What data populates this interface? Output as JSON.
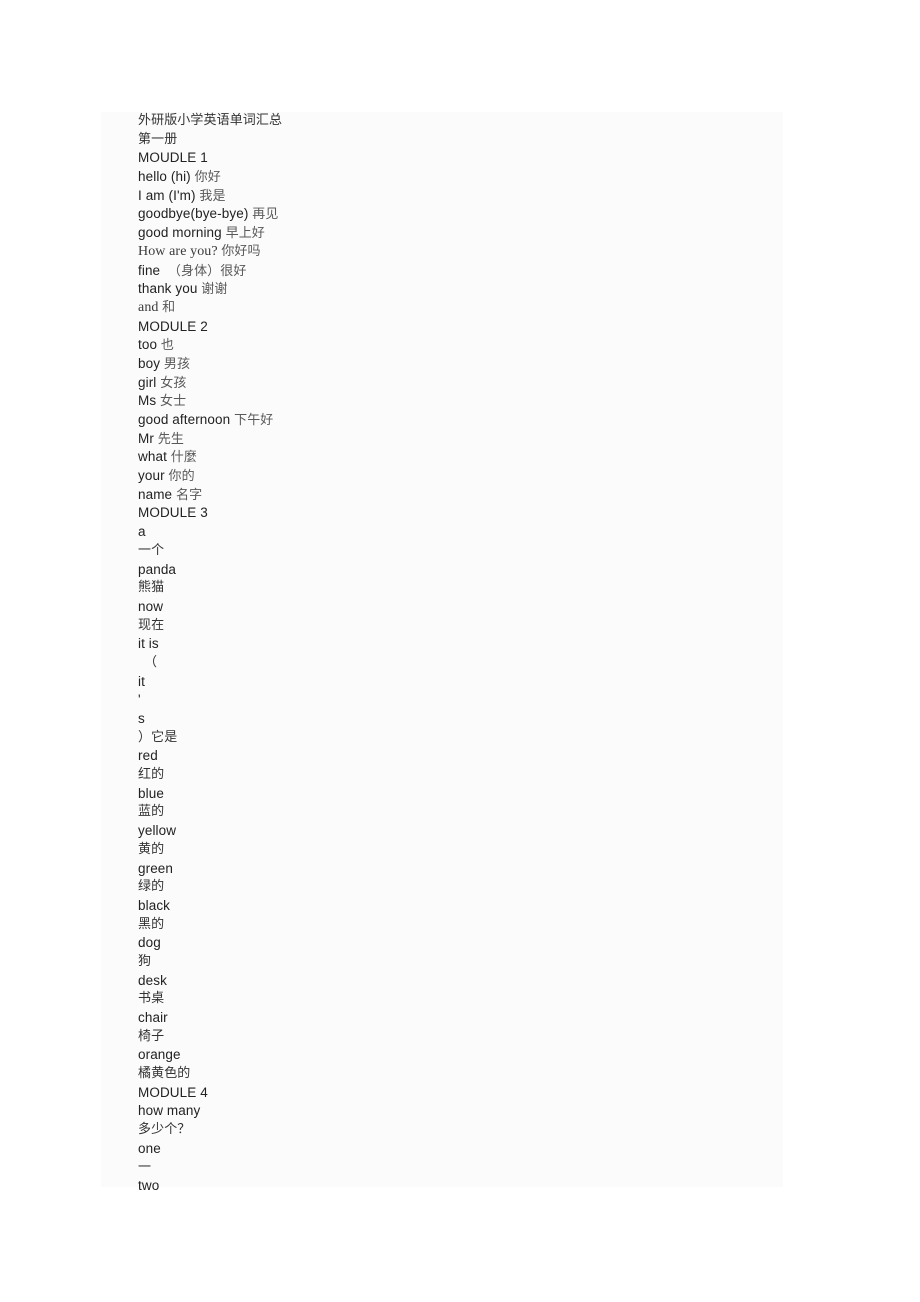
{
  "document": {
    "title": "外研版小学英语单词汇总",
    "background_color": "#ffffff",
    "block_color": "#fbfbfb",
    "text_color": "#2a2a2a",
    "lines": [
      {
        "id": "l1",
        "latin": "",
        "cjk": "外研版小学英语单词汇总",
        "style": "serif",
        "indent": false
      },
      {
        "id": "l2",
        "latin": "",
        "cjk": "第一册",
        "style": "serif",
        "indent": false
      },
      {
        "id": "l3",
        "latin": "MOUDLE 1",
        "cjk": "",
        "style": "sans",
        "indent": false
      },
      {
        "id": "l4",
        "latin": "hello (hi) ",
        "cjk": "你好",
        "style": "sans",
        "indent": false
      },
      {
        "id": "l5",
        "latin": "I am (I'm) ",
        "cjk": "我是",
        "style": "sans",
        "indent": false
      },
      {
        "id": "l6",
        "latin": "goodbye(bye-bye) ",
        "cjk": "再见",
        "style": "sans",
        "indent": false
      },
      {
        "id": "l7",
        "latin": "good morning ",
        "cjk": "早上好",
        "style": "sans",
        "indent": false
      },
      {
        "id": "l8",
        "latin": "How are you? ",
        "cjk": "你好吗",
        "style": "serif",
        "indent": false
      },
      {
        "id": "l9",
        "latin": "fine  ",
        "cjk": "（身体）很好",
        "style": "sans",
        "indent": false
      },
      {
        "id": "l10",
        "latin": "thank you ",
        "cjk": "谢谢",
        "style": "sans",
        "indent": false
      },
      {
        "id": "l11",
        "latin": "and ",
        "cjk": "和",
        "style": "serif",
        "indent": false
      },
      {
        "id": "l12",
        "latin": "MODULE 2",
        "cjk": "",
        "style": "sans",
        "indent": false
      },
      {
        "id": "l13",
        "latin": "too ",
        "cjk": "也",
        "style": "sans",
        "indent": false
      },
      {
        "id": "l14",
        "latin": "boy ",
        "cjk": "男孩",
        "style": "sans",
        "indent": false
      },
      {
        "id": "l15",
        "latin": "girl ",
        "cjk": "女孩",
        "style": "sans",
        "indent": false
      },
      {
        "id": "l16",
        "latin": "Ms ",
        "cjk": "女士",
        "style": "sans",
        "indent": false
      },
      {
        "id": "l17",
        "latin": "good afternoon ",
        "cjk": "下午好",
        "style": "sans",
        "indent": false
      },
      {
        "id": "l18",
        "latin": "Mr ",
        "cjk": "先生",
        "style": "sans",
        "indent": false
      },
      {
        "id": "l19",
        "latin": "what ",
        "cjk": "什麼",
        "style": "sans",
        "indent": false
      },
      {
        "id": "l20",
        "latin": "your ",
        "cjk": "你的",
        "style": "sans",
        "indent": false
      },
      {
        "id": "l21",
        "latin": "name ",
        "cjk": "名字",
        "style": "sans",
        "indent": false
      },
      {
        "id": "l22",
        "latin": "MODULE 3",
        "cjk": "",
        "style": "sans",
        "indent": false
      },
      {
        "id": "l23",
        "latin": "a",
        "cjk": "",
        "style": "sans",
        "indent": false
      },
      {
        "id": "l24",
        "latin": "",
        "cjk": "一个",
        "style": "serif",
        "indent": false
      },
      {
        "id": "l25",
        "latin": "panda",
        "cjk": "",
        "style": "sans",
        "indent": false
      },
      {
        "id": "l26",
        "latin": "",
        "cjk": "熊猫",
        "style": "serif",
        "indent": false
      },
      {
        "id": "l27",
        "latin": "now",
        "cjk": "",
        "style": "sans",
        "indent": false
      },
      {
        "id": "l28",
        "latin": "",
        "cjk": "现在",
        "style": "serif",
        "indent": false
      },
      {
        "id": "l29",
        "latin": "it is",
        "cjk": "",
        "style": "sans",
        "indent": false
      },
      {
        "id": "l30",
        "latin": "",
        "cjk": "（",
        "style": "serif",
        "indent": true
      },
      {
        "id": "l31",
        "latin": "it",
        "cjk": "",
        "style": "sans",
        "indent": false
      },
      {
        "id": "l32",
        "latin": "'",
        "cjk": "",
        "style": "sans",
        "indent": false
      },
      {
        "id": "l33",
        "latin": "s",
        "cjk": "",
        "style": "sans",
        "indent": false
      },
      {
        "id": "l34",
        "latin": "",
        "cjk": "）它是",
        "style": "serif",
        "indent": false
      },
      {
        "id": "l35",
        "latin": "red",
        "cjk": "",
        "style": "sans",
        "indent": false
      },
      {
        "id": "l36",
        "latin": "",
        "cjk": "红的",
        "style": "serif",
        "indent": false
      },
      {
        "id": "l37",
        "latin": "blue",
        "cjk": "",
        "style": "sans",
        "indent": false
      },
      {
        "id": "l38",
        "latin": "",
        "cjk": "蓝的",
        "style": "serif",
        "indent": false
      },
      {
        "id": "l39",
        "latin": "yellow",
        "cjk": "",
        "style": "sans",
        "indent": false
      },
      {
        "id": "l40",
        "latin": "",
        "cjk": "黄的",
        "style": "serif",
        "indent": false
      },
      {
        "id": "l41",
        "latin": "green",
        "cjk": "",
        "style": "sans",
        "indent": false
      },
      {
        "id": "l42",
        "latin": "",
        "cjk": "绿的",
        "style": "serif",
        "indent": false
      },
      {
        "id": "l43",
        "latin": "black",
        "cjk": "",
        "style": "sans",
        "indent": false
      },
      {
        "id": "l44",
        "latin": "",
        "cjk": "黑的",
        "style": "serif",
        "indent": false
      },
      {
        "id": "l45",
        "latin": "dog",
        "cjk": "",
        "style": "sans",
        "indent": false
      },
      {
        "id": "l46",
        "latin": "",
        "cjk": "狗",
        "style": "serif",
        "indent": false
      },
      {
        "id": "l47",
        "latin": "desk",
        "cjk": "",
        "style": "sans",
        "indent": false
      },
      {
        "id": "l48",
        "latin": "",
        "cjk": "书桌",
        "style": "serif",
        "indent": false
      },
      {
        "id": "l49",
        "latin": "chair",
        "cjk": "",
        "style": "sans",
        "indent": false
      },
      {
        "id": "l50",
        "latin": "",
        "cjk": "椅子",
        "style": "serif",
        "indent": false
      },
      {
        "id": "l51",
        "latin": "orange",
        "cjk": "",
        "style": "sans",
        "indent": false
      },
      {
        "id": "l52",
        "latin": "",
        "cjk": "橘黄色的",
        "style": "serif",
        "indent": false
      },
      {
        "id": "l53",
        "latin": "MODULE 4",
        "cjk": "",
        "style": "sans",
        "indent": false
      },
      {
        "id": "l54",
        "latin": "how many",
        "cjk": "",
        "style": "sans",
        "indent": false
      },
      {
        "id": "l55",
        "latin": "",
        "cjk": "多少个？",
        "style": "serif",
        "indent": false
      },
      {
        "id": "l56",
        "latin": "one",
        "cjk": "",
        "style": "sans",
        "indent": false
      },
      {
        "id": "l57",
        "latin": "",
        "cjk": "一",
        "style": "serif",
        "indent": false
      },
      {
        "id": "l58",
        "latin": "two",
        "cjk": "",
        "style": "sans",
        "indent": false
      }
    ]
  }
}
